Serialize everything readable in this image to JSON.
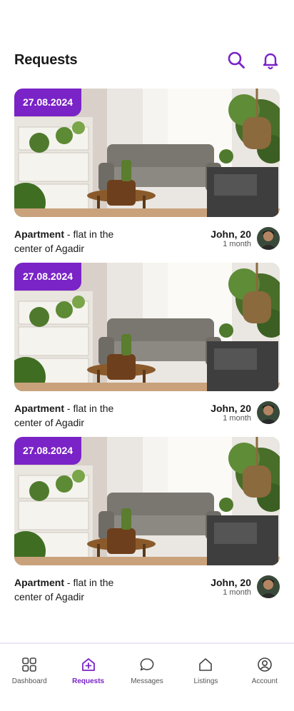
{
  "header": {
    "title": "Requests",
    "search_icon": "search-icon",
    "notification_icon": "bell-icon",
    "accent": "#7a23c7"
  },
  "requests": [
    {
      "date": "27.08.2024",
      "type": "Apartment",
      "sep": " - ",
      "desc": "flat in the center of Agadir",
      "owner": "John, 20",
      "duration": "1 month"
    },
    {
      "date": "27.08.2024",
      "type": "Apartment",
      "sep": " - ",
      "desc": "flat in the center of Agadir",
      "owner": "John, 20",
      "duration": "1 month"
    },
    {
      "date": "27.08.2024",
      "type": "Apartment",
      "sep": " - ",
      "desc": "flat in the center of Agadir",
      "owner": "John, 20",
      "duration": "1 month"
    }
  ],
  "tabs": [
    {
      "label": "Dashboard",
      "icon": "grid-icon",
      "active": false
    },
    {
      "label": "Requests",
      "icon": "home-plus-icon",
      "active": true
    },
    {
      "label": "Messages",
      "icon": "chat-icon",
      "active": false
    },
    {
      "label": "Listings",
      "icon": "house-icon",
      "active": false
    },
    {
      "label": "Account",
      "icon": "user-circle-icon",
      "active": false
    }
  ]
}
